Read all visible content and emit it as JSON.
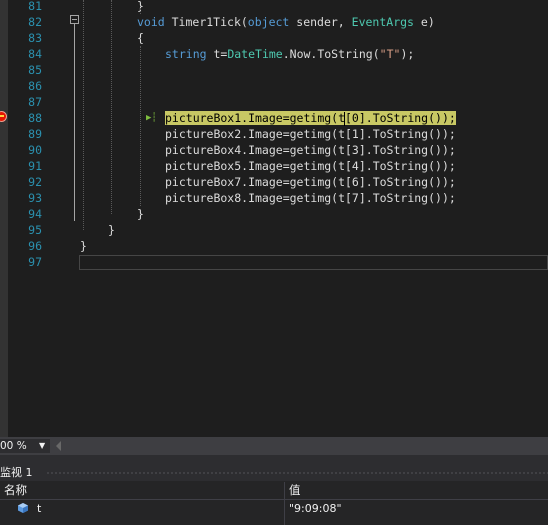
{
  "editor": {
    "lines": [
      {
        "num": "81",
        "segments": [
          {
            "text": "}",
            "cls": ""
          }
        ]
      },
      {
        "num": "82",
        "segments": [
          {
            "text": "void",
            "cls": "kw"
          },
          {
            "text": " Timer1Tick(",
            "cls": ""
          },
          {
            "text": "object",
            "cls": "kw"
          },
          {
            "text": " sender, ",
            "cls": ""
          },
          {
            "text": "EventArgs",
            "cls": "ty"
          },
          {
            "text": " e)",
            "cls": ""
          }
        ]
      },
      {
        "num": "83",
        "segments": [
          {
            "text": "{",
            "cls": ""
          }
        ]
      },
      {
        "num": "84",
        "segments": [
          {
            "text": "string",
            "cls": "kw"
          },
          {
            "text": " t=",
            "cls": ""
          },
          {
            "text": "DateTime",
            "cls": "ty"
          },
          {
            "text": ".Now.ToString(",
            "cls": ""
          },
          {
            "text": "\"T\"",
            "cls": "st"
          },
          {
            "text": ");",
            "cls": ""
          }
        ]
      },
      {
        "num": "85",
        "segments": []
      },
      {
        "num": "86",
        "segments": []
      },
      {
        "num": "87",
        "segments": []
      },
      {
        "num": "88",
        "segments": [
          {
            "text": "pictureBox1.Image=getimg(t[0].ToString());",
            "cls": "hl"
          }
        ]
      },
      {
        "num": "89",
        "segments": [
          {
            "text": "pictureBox2.Image=getimg(t[1].ToString());",
            "cls": ""
          }
        ]
      },
      {
        "num": "90",
        "segments": [
          {
            "text": "pictureBox4.Image=getimg(t[3].ToString());",
            "cls": ""
          }
        ]
      },
      {
        "num": "91",
        "segments": [
          {
            "text": "pictureBox5.Image=getimg(t[4].ToString());",
            "cls": ""
          }
        ]
      },
      {
        "num": "92",
        "segments": [
          {
            "text": "pictureBox7.Image=getimg(t[6].ToString());",
            "cls": ""
          }
        ]
      },
      {
        "num": "93",
        "segments": [
          {
            "text": "pictureBox8.Image=getimg(t[7].ToString());",
            "cls": ""
          }
        ]
      },
      {
        "num": "94",
        "segments": [
          {
            "text": "}",
            "cls": ""
          }
        ]
      },
      {
        "num": "95",
        "segments": [
          {
            "text": "}",
            "cls": ""
          }
        ]
      },
      {
        "num": "96",
        "segments": [
          {
            "text": "}",
            "cls": ""
          }
        ]
      },
      {
        "num": "97",
        "segments": []
      }
    ],
    "breakpoint_icon": "breakpoint-icon",
    "current_statement_icon": "current-statement-arrow-icon"
  },
  "statusbar": {
    "zoom": "00 %",
    "zoom_arrow": "▼"
  },
  "watch": {
    "title": "监视 1",
    "columns": {
      "name": "名称",
      "value": "值"
    },
    "rows": [
      {
        "name": "t",
        "value": "\"9:09:08\"",
        "icon": "variable-icon"
      }
    ]
  }
}
